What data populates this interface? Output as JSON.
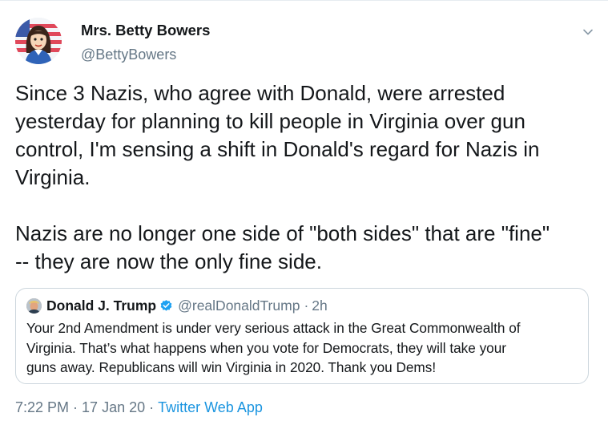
{
  "author": {
    "display_name": "Mrs. Betty Bowers",
    "handle": "@BettyBowers",
    "avatar_icon": "cartoon-woman-flag-avatar"
  },
  "tweet": {
    "paragraph1_lines": [
      "Since 3 Nazis, who agree with Donald, were arrested",
      "yesterday for planning to kill people in Virginia over gun",
      "control, I'm sensing a shift in Donald's regard for Nazis in",
      "Virginia."
    ],
    "paragraph2_lines": [
      "Nazis are no longer one side of \"both sides\" that are \"fine\"",
      "-- they are now the only fine side."
    ]
  },
  "quoted_tweet": {
    "display_name": "Donald J. Trump",
    "handle": "@realDonaldTrump",
    "separator": "·",
    "time": "2h",
    "verified_icon": "verified-badge-icon",
    "text_lines": [
      "Your 2nd Amendment is under very serious attack in the Great Commonwealth of",
      "Virginia. That’s what happens when you vote for Democrats, they will take your",
      "guns away. Republicans will win Virginia in 2020. Thank you Dems!"
    ]
  },
  "meta": {
    "time": "7:22 PM",
    "separator": "·",
    "date": "17 Jan 20",
    "source": "Twitter Web App"
  },
  "colors": {
    "text": "#14171a",
    "secondary": "#657786",
    "link": "#1b95e0",
    "verified": "#1da1f2",
    "border": "#ccd6dd"
  }
}
